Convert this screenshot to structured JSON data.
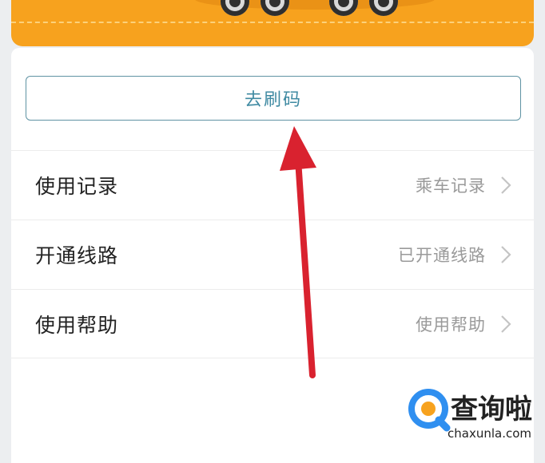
{
  "primary_button": {
    "label": "去刷码"
  },
  "menu": [
    {
      "title": "使用记录",
      "subtitle": "乘车记录"
    },
    {
      "title": "开通线路",
      "subtitle": "已开通线路"
    },
    {
      "title": "使用帮助",
      "subtitle": "使用帮助"
    }
  ],
  "watermark": {
    "brand": "查询啦",
    "site": "chaxunla.com"
  },
  "colors": {
    "banner": "#f7a21e",
    "button_border": "#5f93a3",
    "button_text": "#3f8aa2",
    "annotation_arrow": "#d9222f",
    "watermark_blue": "#2f8ff0",
    "watermark_orange": "#f7a21e"
  },
  "icons": [
    "chevron-right-icon",
    "bus-wheel-icon",
    "search-logo-icon"
  ]
}
